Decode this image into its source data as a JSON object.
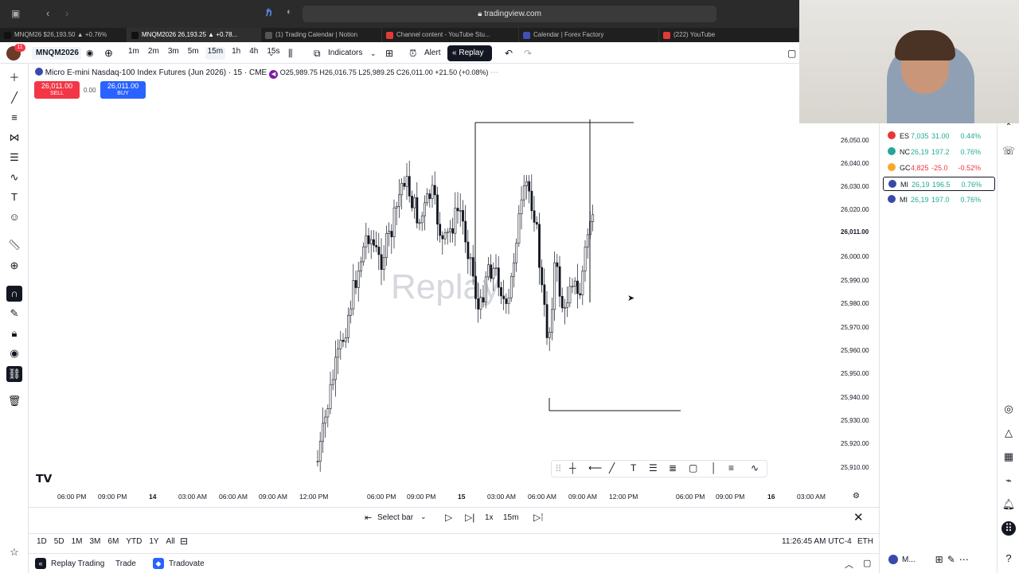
{
  "browser": {
    "url": "tradingview.com",
    "tabs": [
      {
        "label": "MNQM26 $26,193.50 ▲ +0.76%",
        "color": "#111111"
      },
      {
        "label": "MNQM2026 26,193.25 ▲ +0.78...",
        "color": "#111111"
      },
      {
        "label": "(1) Trading Calendar | Notion",
        "color": "#555555"
      },
      {
        "label": "Channel content - YouTube Stu...",
        "color": "#e53935"
      },
      {
        "label": "Calendar | Forex Factory",
        "color": "#3f51b5"
      },
      {
        "label": "(222) YouTube",
        "color": "#e53935"
      }
    ]
  },
  "toolbar": {
    "symbol": "MNQM2026",
    "notif_count": "11",
    "timeframes": [
      "1m",
      "2m",
      "3m",
      "5m",
      "15m",
      "1h",
      "4h",
      "15s"
    ],
    "selected_timeframe": "15m",
    "indicators_label": "Indicators",
    "alert_label": "Alert",
    "replay_label": "Replay"
  },
  "legend": {
    "title": "Micro E-mini Nasdaq-100 Index Futures (Jun 2026) · 15 · CME",
    "ohlc": "O25,989.75 H26,016.75 L25,989.25 C26,011.00 +21.50 (+0.08%)"
  },
  "trade": {
    "sell_price": "26,011.00",
    "sell_label": "SELL",
    "spread": "0.00",
    "buy_price": "26,011.00",
    "buy_label": "BUY",
    "sell_color": "#f23645",
    "buy_color": "#2962ff"
  },
  "chart_data": {
    "type": "candlestick",
    "watermark": "Replay",
    "price_axis": [
      "26,050.00",
      "26,040.00",
      "26,030.00",
      "26,020.00",
      "26,011.00",
      "26,000.00",
      "25,990.00",
      "25,980.00",
      "25,970.00",
      "25,960.00",
      "25,950.00",
      "25,940.00",
      "25,930.00",
      "25,920.00",
      "25,910.00"
    ],
    "time_axis": [
      "06:00 PM",
      "09:00 PM",
      "14",
      "03:00 AM",
      "06:00 AM",
      "09:00 AM",
      "12:00 PM",
      "06:00 PM",
      "09:00 PM",
      "15",
      "03:00 AM",
      "06:00 AM",
      "09:00 AM",
      "12:00 PM",
      "06:00 PM",
      "09:00 PM",
      "16",
      "03:00 AM"
    ],
    "ylim": [
      25905,
      26055
    ]
  },
  "replay": {
    "select_bar": "Select bar",
    "speed": "1x",
    "interval": "15m"
  },
  "ranges": [
    "1D",
    "5D",
    "1M",
    "3M",
    "6M",
    "YTD",
    "1Y",
    "All"
  ],
  "status": {
    "time": "11:26:45 AM UTC-4",
    "session": "ETH"
  },
  "bottom_tabs": {
    "replay_trading": "Replay Trading",
    "trade": "Trade",
    "broker": "Tradovate"
  },
  "watchlist": [
    {
      "sym": "ES",
      "price": "7,035",
      "chg": "31.00",
      "pct": "0.44%",
      "dir": "up",
      "icon_color": "#e53935"
    },
    {
      "sym": "NC",
      "price": "26,19",
      "chg": "197.2",
      "pct": "0.76%",
      "dir": "up",
      "icon_color": "#26a69a"
    },
    {
      "sym": "GC",
      "price": "4,825",
      "chg": "-25.0",
      "pct": "-0.52%",
      "dir": "down",
      "icon_color": "#f9a825"
    },
    {
      "sym": "MI",
      "price": "26,19",
      "chg": "196.5",
      "pct": "0.76%",
      "dir": "up",
      "icon_color": "#3949ab"
    },
    {
      "sym": "MI",
      "price": "26,19",
      "chg": "197.0",
      "pct": "0.76%",
      "dir": "up",
      "icon_color": "#3949ab"
    }
  ],
  "bottom_right": {
    "label": "M..."
  }
}
